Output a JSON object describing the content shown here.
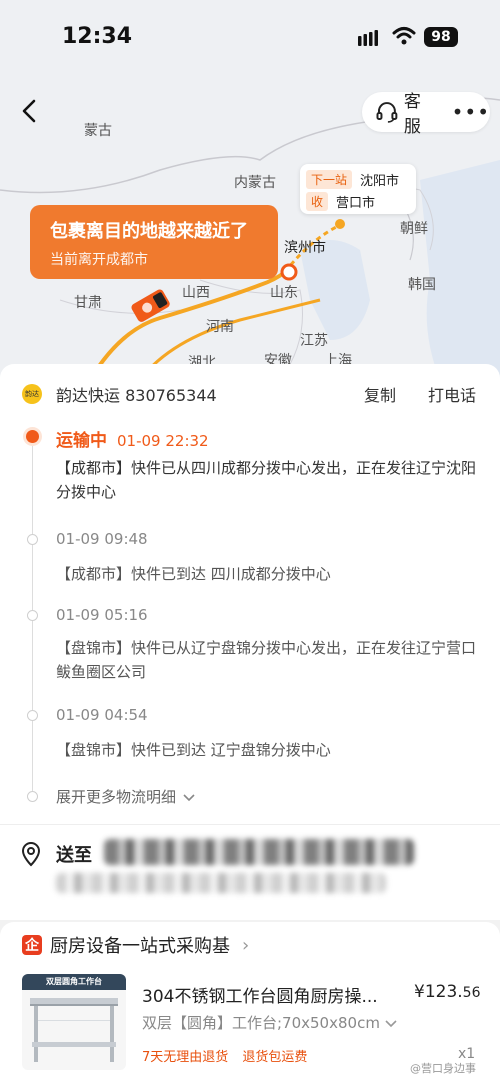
{
  "status_bar": {
    "time": "12:34",
    "battery": "98"
  },
  "header": {
    "service_label": "客服",
    "more": "•••"
  },
  "map": {
    "labels": {
      "mongolia": "蒙古",
      "inner_mongolia": "内蒙古",
      "gansu": "甘肃",
      "shanxi": "山西",
      "shandong": "山东",
      "henan": "河南",
      "jiangsu": "江苏",
      "hubei": "湖北",
      "anhui": "安徽",
      "shanghai": "上海",
      "binzhou": "滨州市",
      "north_korea": "朝鲜",
      "south_korea": "韩国"
    },
    "next_station": {
      "tag": "下一站",
      "city": "沈阳市"
    },
    "receive": {
      "tag": "收",
      "city": "营口市"
    },
    "banner": {
      "title": "包裹离目的地越来越近了",
      "subtitle": "当前离开成都市"
    }
  },
  "tracking": {
    "carrier_logo": "韵达",
    "carrier": "韵达快运 830765344",
    "copy": "复制",
    "call": "打电话",
    "events": [
      {
        "status": "运输中",
        "time": "01-09 22:32",
        "desc": "【成都市】快件已从四川成都分拨中心发出，正在发往辽宁沈阳分拨中心"
      },
      {
        "status": "",
        "time": "01-09 09:48",
        "desc": "【成都市】快件已到达 四川成都分拨中心"
      },
      {
        "status": "",
        "time": "01-09 05:16",
        "desc": "【盘锦市】快件已从辽宁盘锦分拨中心发出，正在发往辽宁营口鲅鱼圈区公司"
      },
      {
        "status": "",
        "time": "01-09 04:54",
        "desc": "【盘锦市】快件已到达 辽宁盘锦分拨中心"
      }
    ],
    "expand": "展开更多物流明细"
  },
  "address": {
    "label": "送至"
  },
  "shop": {
    "icon": "企",
    "name": "厨房设备一站式采购基",
    "product_image_title": "双层圆角工作台",
    "title": "304不锈钢工作台圆角厨房操...",
    "price_main": "¥123.",
    "price_cents": "56",
    "spec": "双层【圆角】工作台;70x50x80cm",
    "tags": [
      "7天无理由退货",
      "退货包运费"
    ],
    "qty": "x1"
  },
  "watermark": "@营口身边事"
}
